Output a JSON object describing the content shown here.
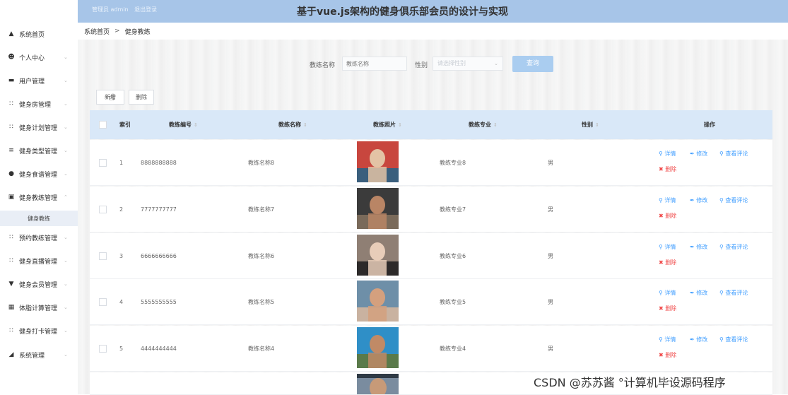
{
  "header": {
    "admin_text": "管理员 admin",
    "logout": "退出登录",
    "title": "基于vue.js架构的健身俱乐部会员的设计与实现"
  },
  "breadcrumb": {
    "home": "系统首页",
    "separator": ">",
    "current": "健身教练"
  },
  "sidebar": {
    "items": [
      {
        "label": "系统首页",
        "icon": "home-icon"
      },
      {
        "label": "个人中心",
        "icon": "user-icon"
      },
      {
        "label": "用户管理",
        "icon": "briefcase-icon"
      },
      {
        "label": "健身房管理",
        "icon": "grid-icon"
      },
      {
        "label": "健身计划管理",
        "icon": "grid-icon"
      },
      {
        "label": "健身类型管理",
        "icon": "list-icon"
      },
      {
        "label": "健身食谱管理",
        "icon": "bulb-icon"
      },
      {
        "label": "健身教练管理",
        "icon": "folder-icon"
      },
      {
        "label": "预约教练管理",
        "icon": "grid-icon"
      },
      {
        "label": "健身直播管理",
        "icon": "grid-icon"
      },
      {
        "label": "健身会员管理",
        "icon": "medal-icon"
      },
      {
        "label": "体脂计算管理",
        "icon": "trash-icon"
      },
      {
        "label": "健身打卡管理",
        "icon": "grid-icon"
      },
      {
        "label": "系统管理",
        "icon": "chart-icon"
      }
    ],
    "active_submenu": "健身教练"
  },
  "search": {
    "name_label": "教练名称",
    "name_placeholder": "教练名称",
    "gender_label": "性别",
    "gender_placeholder": "请选择性别",
    "query_button": "查询"
  },
  "toolbar": {
    "add": "新增",
    "delete": "删除"
  },
  "table": {
    "headers": {
      "index": "索引",
      "code": "教练编号",
      "name": "教练名称",
      "photo": "教练照片",
      "specialty": "教练专业",
      "gender": "性别",
      "actions": "操作"
    },
    "actions": {
      "detail": "详情",
      "edit": "修改",
      "comments": "查看评论",
      "delete": "删除"
    },
    "rows": [
      {
        "index": "1",
        "code": "8888888888",
        "name": "教练名称8",
        "specialty": "教练专业8",
        "gender": "男"
      },
      {
        "index": "2",
        "code": "7777777777",
        "name": "教练名称7",
        "specialty": "教练专业7",
        "gender": "男"
      },
      {
        "index": "3",
        "code": "6666666666",
        "name": "教练名称6",
        "specialty": "教练专业6",
        "gender": "男"
      },
      {
        "index": "4",
        "code": "5555555555",
        "name": "教练名称5",
        "specialty": "教练专业5",
        "gender": "男"
      },
      {
        "index": "5",
        "code": "4444444444",
        "name": "教练名称4",
        "specialty": "教练专业4",
        "gender": "男"
      }
    ]
  },
  "watermark": "CSDN @苏苏酱  °计算机毕设源码程序"
}
